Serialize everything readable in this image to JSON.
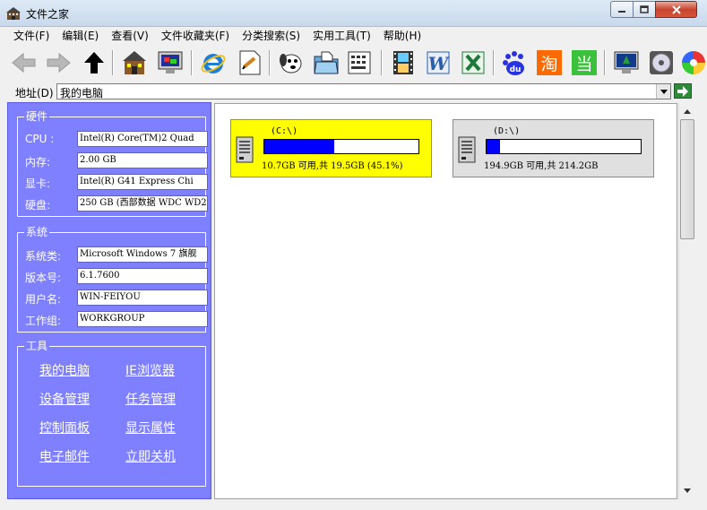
{
  "window": {
    "title": "文件之家",
    "icon": "building-icon",
    "controls": [
      "minimize-icon",
      "maximize-icon",
      "close-icon"
    ]
  },
  "menu": [
    {
      "label": "文件(F)"
    },
    {
      "label": "编辑(E)"
    },
    {
      "label": "查看(V)"
    },
    {
      "label": "文件收藏夹(F)"
    },
    {
      "label": "分类搜索(S)"
    },
    {
      "label": "实用工具(T)"
    },
    {
      "label": "帮助(H)"
    }
  ],
  "toolbar": {
    "buttons": [
      "back-arrow-icon",
      "forward-arrow-icon",
      "up-arrow-icon",
      "house-icon",
      "monitor-icon",
      "ie-icon",
      "notepad-icon",
      "dog-icon",
      "folder-icon",
      "keyboard-icon",
      "film-icon",
      "word-icon",
      "excel-icon",
      "baidu-icon",
      "taobao-icon",
      "dangdang-icon",
      "screen-icon",
      "cd-icon",
      "color-icon"
    ],
    "taobao_text": "淘",
    "dangdang_text": "当",
    "baidu_text": "du"
  },
  "address": {
    "label": "地址(D)",
    "value": "我的电脑"
  },
  "hardware": {
    "title": "硬件",
    "fields": [
      {
        "label": "CPU :",
        "value": "Intel(R) Core(TM)2 Quad"
      },
      {
        "label": "内存:",
        "value": "2.00 GB"
      },
      {
        "label": "显卡:",
        "value": "Intel(R) G41 Express Chi"
      },
      {
        "label": "硬盘:",
        "value": "250 GB (西部数据 WDC WD2"
      }
    ]
  },
  "system": {
    "title": "系统",
    "fields": [
      {
        "label": "系统类:",
        "value": "Microsoft Windows 7 旗舰"
      },
      {
        "label": "版本号:",
        "value": "6.1.7600"
      },
      {
        "label": "用户名:",
        "value": "WIN-FEIYOU"
      },
      {
        "label": "工作组:",
        "value": "WORKGROUP"
      }
    ]
  },
  "tools": {
    "title": "工具",
    "links": [
      "我的电脑",
      "IE浏览器",
      "设备管理",
      "任务管理",
      "控制面板",
      "显示属性",
      "电子邮件",
      "立即关机"
    ]
  },
  "drives": [
    {
      "label": "(C:\\)",
      "info": "10.7GB 可用,共 19.5GB (45.1%)",
      "used_fraction": 0.451,
      "bg": "#ffff00"
    },
    {
      "label": "(D:\\)",
      "info": "194.9GB 可用,共 214.2GB",
      "used_fraction": 0.09,
      "bg": "#e0e0e0"
    }
  ],
  "colors": {
    "panel": "#7f80ff",
    "bar_fill": "#0000ff",
    "selected_drive": "#ffff00"
  }
}
